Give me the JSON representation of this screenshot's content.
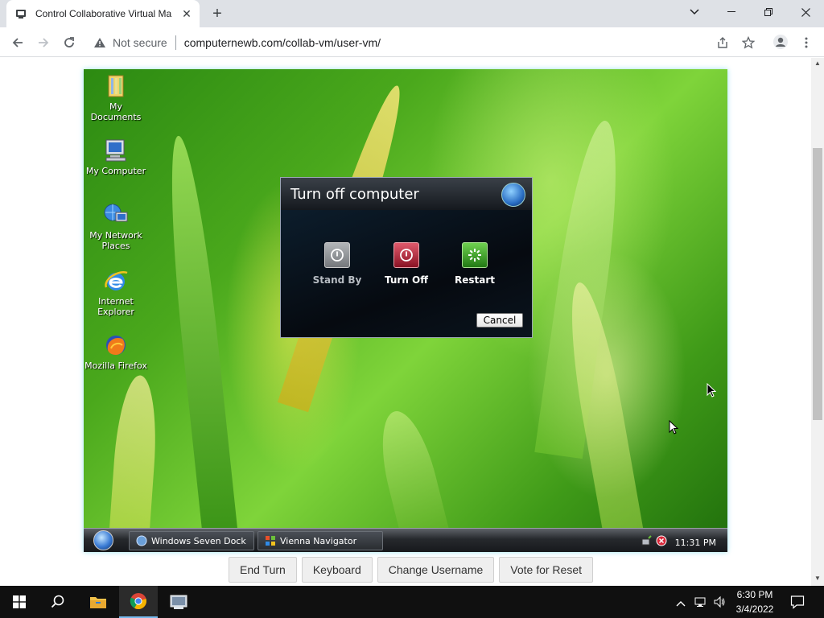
{
  "browser": {
    "tab_title": "Control Collaborative Virtual Ma",
    "tab_close": "✕",
    "new_tab": "+",
    "security_label": "Not secure",
    "url": "computernewb.com/collab-vm/user-vm/"
  },
  "vm": {
    "desktop_icons": [
      {
        "label": "My Documents"
      },
      {
        "label": "My Computer"
      },
      {
        "label": "My Network Places"
      },
      {
        "label": "Internet Explorer"
      },
      {
        "label": "Mozilla Firefox"
      }
    ],
    "dialog": {
      "title": "Turn off computer",
      "buttons": [
        {
          "label": "Stand By",
          "color": "#8a8d91"
        },
        {
          "label": "Turn Off",
          "color": "#b8233a"
        },
        {
          "label": "Restart",
          "color": "#3c9a2a"
        }
      ],
      "cancel": "Cancel"
    },
    "taskbar": {
      "tasks": [
        {
          "label": "Windows Seven Dock"
        },
        {
          "label": "Vienna Navigator"
        }
      ],
      "clock": "11:31 PM"
    }
  },
  "controls": {
    "end_turn": "End Turn",
    "keyboard": "Keyboard",
    "change_username": "Change Username",
    "vote_reset": "Vote for Reset"
  },
  "os": {
    "time": "6:30 PM",
    "date": "3/4/2022"
  },
  "colors": {
    "tab_bar": "#dee1e6",
    "os_taskbar": "#101010",
    "accent": "#76b9ed"
  }
}
